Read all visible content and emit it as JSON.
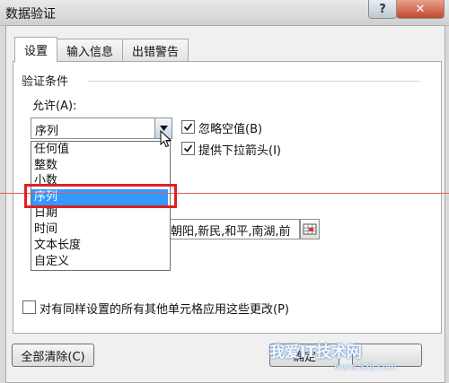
{
  "window": {
    "title": "数据验证",
    "help_label": "?",
    "close_label": "✕"
  },
  "tabs": [
    {
      "label": "设置",
      "active": true
    },
    {
      "label": "输入信息",
      "active": false
    },
    {
      "label": "出错警告",
      "active": false
    }
  ],
  "settings": {
    "section_title": "验证条件",
    "allow_label": "允许(A):",
    "allow_value": "序列",
    "ignore_blank_label": "忽略空值(B)",
    "ignore_blank_checked": true,
    "in_cell_dropdown_label": "提供下拉箭头(I)",
    "in_cell_dropdown_checked": true,
    "dropdown_options": [
      "任何值",
      "整数",
      "小数",
      "序列",
      "日期",
      "时间",
      "文本长度",
      "自定义"
    ],
    "dropdown_selected_index": 3,
    "source_value": "朝阳,新民,和平,南湖,前",
    "apply_all_label": "对有同样设置的所有其他单元格应用这些更改(P)",
    "apply_all_checked": false
  },
  "footer": {
    "clear_all_label": "全部清除(C)",
    "ok_label": "确定"
  },
  "watermark": {
    "text": "我爱IT技术网",
    "url": "www.52ij.com"
  },
  "colors": {
    "selection": "#3399ff",
    "highlight_box": "#e02020",
    "guide_line": "#e35b5b",
    "close_button": "#c2472b"
  }
}
